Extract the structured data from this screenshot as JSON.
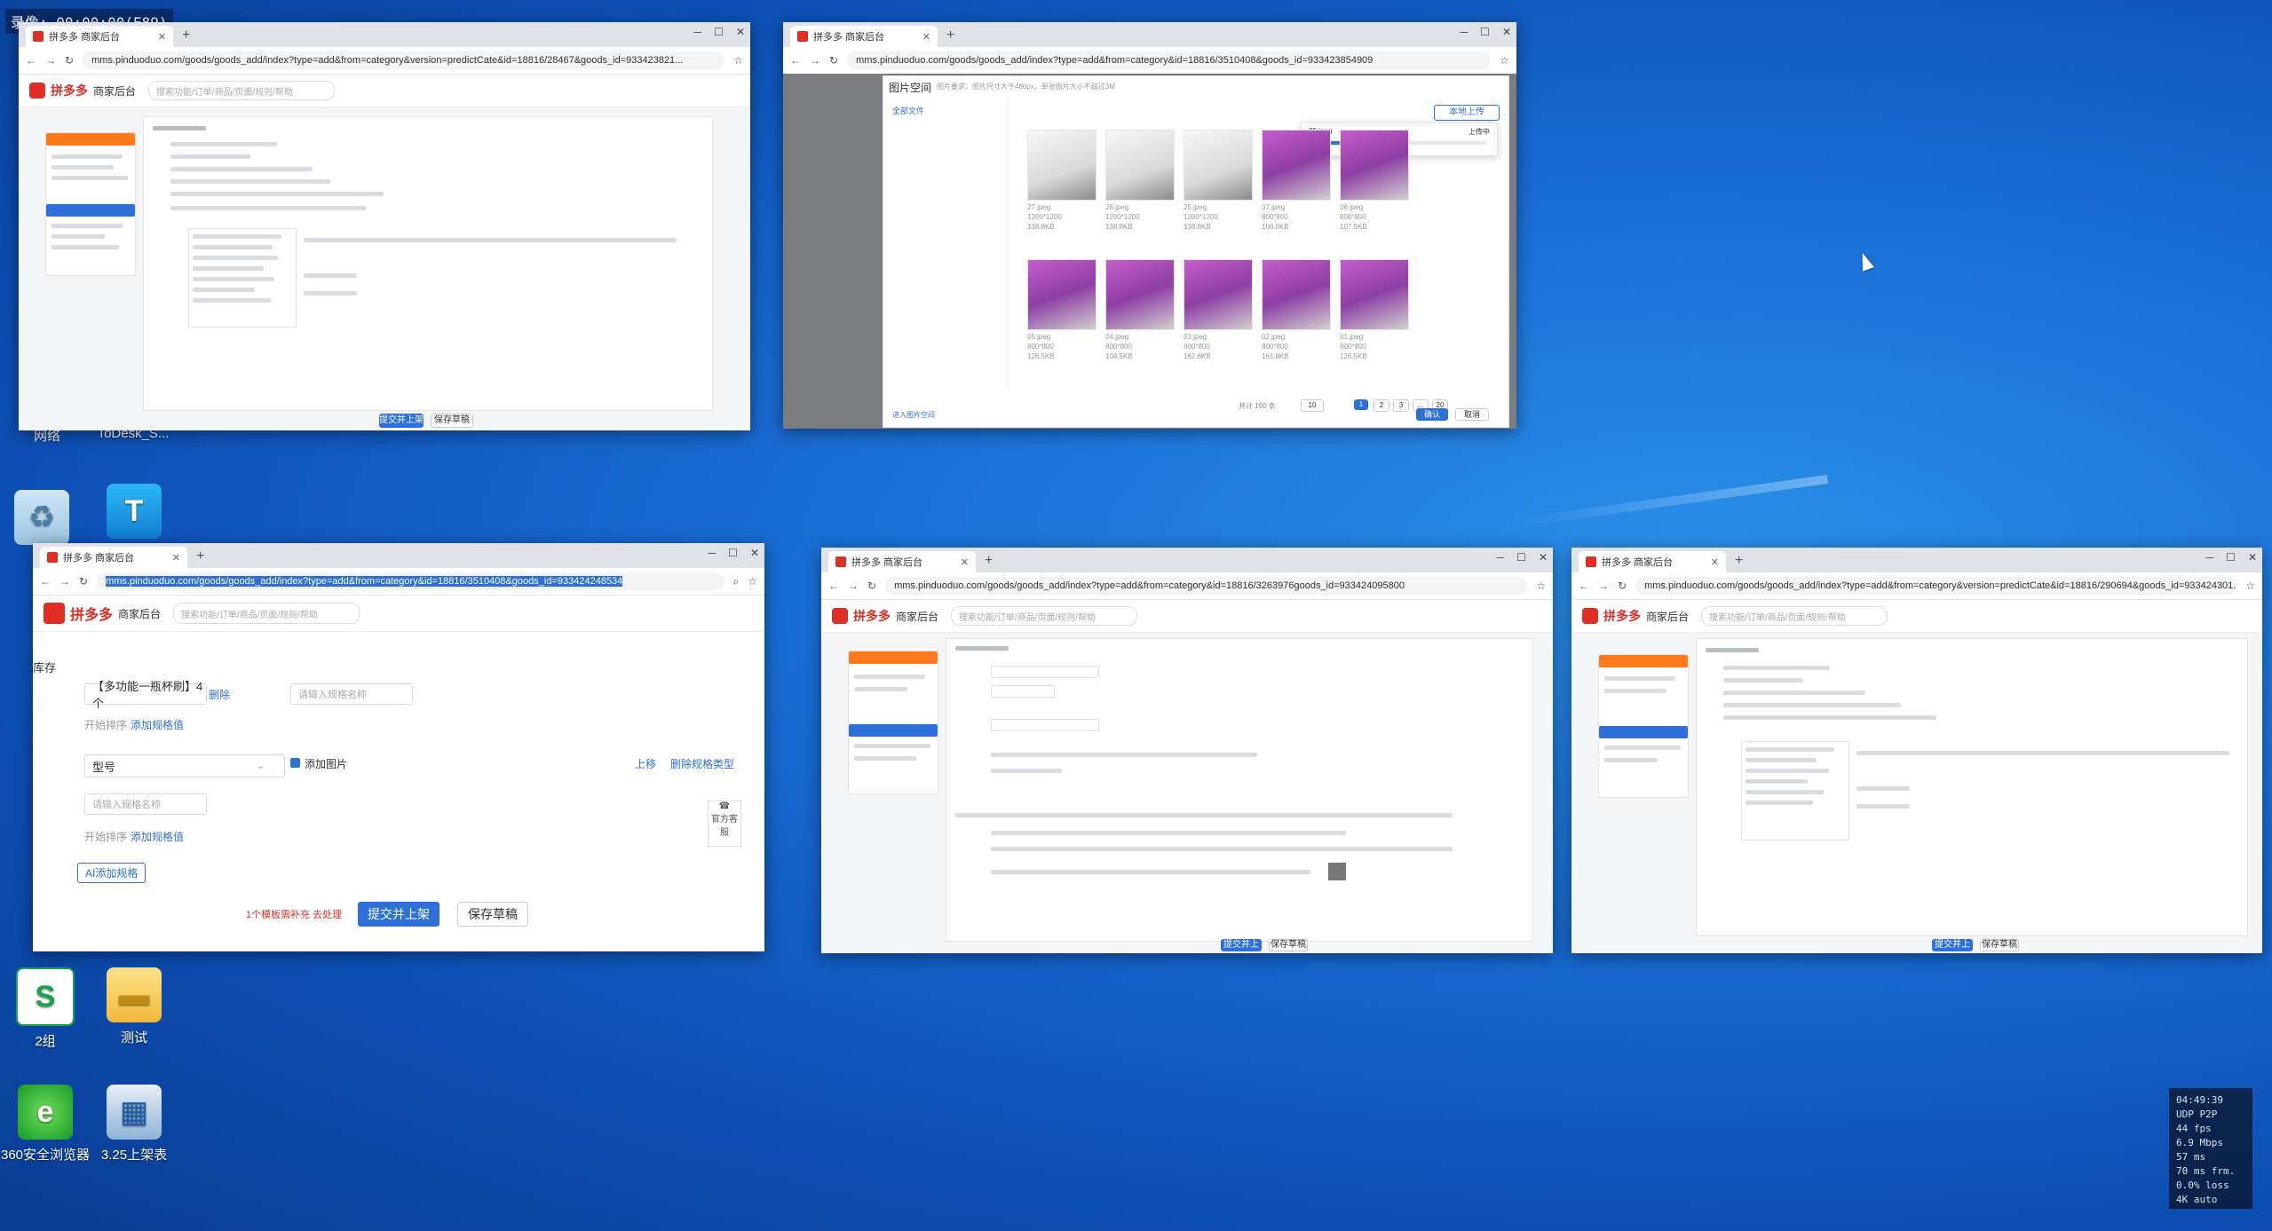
{
  "recording_label": "录像: 00:00:00(E89)",
  "desktop_icons": {
    "network": "网络",
    "todesk": "ToDesk_S...",
    "sheet": "2组",
    "folder": "测试",
    "browser360": "360安全浏览器",
    "app325": "3.25上架表"
  },
  "browser_tab_title": "拼多多 商家后台",
  "pdd_brand": "拼多多",
  "pdd_sub": "商家后台",
  "search_placeholder": "搜索功能/订单/商品/页面/规则/帮助",
  "windows": {
    "w1": {
      "url": "mms.pinduoduo.com/goods/goods_add/index?type=add&from=category&version=predictCate&id=18816/28467&goods_id=933423821..."
    },
    "w2": {
      "url": "mms.pinduoduo.com/goods/goods_add/index?type=add&from=category&id=18816/3510408&goods_id=933423854909",
      "title": "图片空间",
      "subtitle": "图片要求：图片尺寸大于480px，单张图片大小不超过3M",
      "folder_all": "全部文件",
      "upload_btn": "本地上传",
      "upload_file": "25.jpeg",
      "upload_status": "上传中",
      "upload_progress": 0.56,
      "thumbs": [
        {
          "name": "27.jpeg",
          "size": "1200*1200",
          "kb": "138.8KB",
          "style": "white"
        },
        {
          "name": "26.jpeg",
          "size": "1200*1200",
          "kb": "138.8KB",
          "style": "white"
        },
        {
          "name": "25.jpeg",
          "size": "1200*1200",
          "kb": "138.8KB",
          "style": "white"
        },
        {
          "name": "07.jpeg",
          "size": "800*800",
          "kb": "106.0KB",
          "style": "purple"
        },
        {
          "name": "06.jpeg",
          "size": "800*800",
          "kb": "107.5KB",
          "style": "purple"
        },
        {
          "name": "05.jpeg",
          "size": "800*800",
          "kb": "126.5KB",
          "style": "purple"
        },
        {
          "name": "04.jpeg",
          "size": "800*800",
          "kb": "104.5KB",
          "style": "purple"
        },
        {
          "name": "03.jpeg",
          "size": "800*800",
          "kb": "162.6KB",
          "style": "purple"
        },
        {
          "name": "02.jpeg",
          "size": "800*800",
          "kb": "161.8KB",
          "style": "purple"
        },
        {
          "name": "01.jpeg",
          "size": "800*800",
          "kb": "126.5KB",
          "style": "purple"
        }
      ],
      "pager_total": "共计 190 条",
      "pager_page_size": "10",
      "pager_pages": [
        "1",
        "2",
        "3",
        "...",
        "20"
      ],
      "footer_link": "进入图片空间",
      "confirm": "确认",
      "cancel": "取消"
    },
    "w3": {
      "url": "mms.pinduoduo.com/goods/goods_add/index?type=add&from=category&id=18816/3510408&goods_id=933424248534",
      "side_label": "库存",
      "spec_value": "【多功能一瓶杯刷】4个",
      "delete": "删除",
      "input_placeholder": "请输入规格名称",
      "batch_label": "开始排序",
      "add_spec_value": "添加规格值",
      "model_select": "型号",
      "add_image": "添加图片",
      "move_up": "上移",
      "delete_spec_type": "删除规格类型",
      "ai_add": "AI添加规格",
      "helper_text": "1个模板需补充 去处理",
      "submit": "提交并上架",
      "save_draft": "保存草稿",
      "side_tool": "官方客服"
    },
    "w4": {
      "url": "mms.pinduoduo.com/goods/goods_add/index?type=add&from=category&id=18816/3263976goods_id=933424095800"
    },
    "w5": {
      "url": "mms.pinduoduo.com/goods/goods_add/index?type=add&from=category&version=predictCate&id=18816/290694&goods_id=933424301..."
    }
  },
  "stats": {
    "lines": [
      "04:49:39",
      "UDP P2P",
      "44 fps",
      "6.9 Mbps",
      "57 ms",
      "70 ms frm.",
      "0.0% loss",
      "4K auto"
    ]
  }
}
